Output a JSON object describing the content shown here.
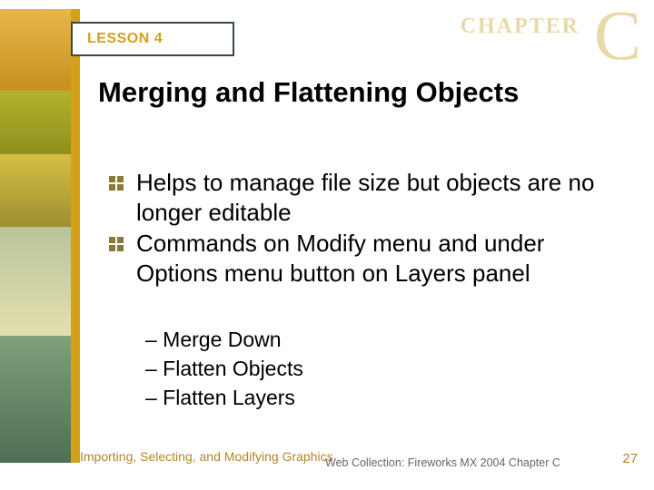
{
  "header": {
    "lesson_label": "LESSON 4",
    "chapter_word": "CHAPTER",
    "chapter_letter": "C"
  },
  "title": "Merging and Flattening Objects",
  "bullets": [
    "Helps to manage file size but objects are no longer editable",
    "Commands on Modify menu and under Options menu button on Layers panel"
  ],
  "sub_bullets": [
    "– Merge Down",
    "– Flatten Objects",
    "– Flatten Layers"
  ],
  "footer": {
    "left": "Importing, Selecting, and Modifying Graphics",
    "center": "Web Collection: Fireworks MX 2004 Chapter C",
    "page": "27"
  }
}
